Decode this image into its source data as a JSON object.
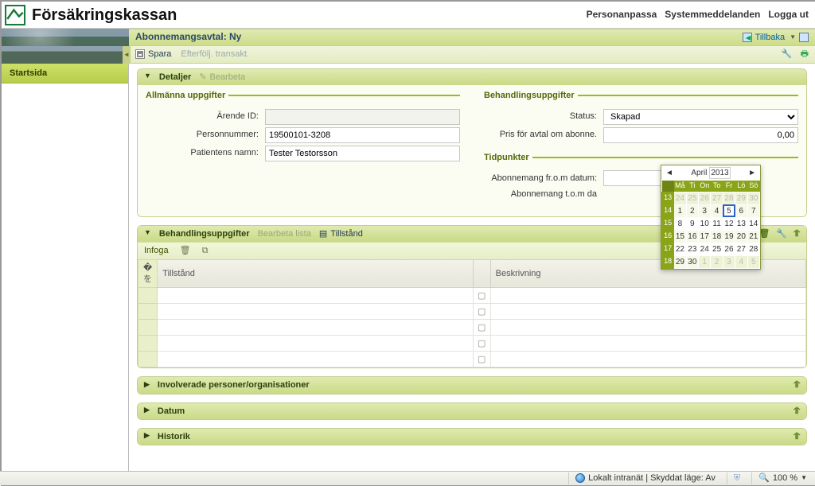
{
  "brand": {
    "name": "Försäkringskassan"
  },
  "topnav": {
    "personalize": "Personanpassa",
    "sysmsg": "Systemmeddelanden",
    "logout": "Logga ut"
  },
  "page": {
    "title": "Abonnemangsavtal: Ny",
    "back": "Tillbaka"
  },
  "toolbar": {
    "save": "Spara",
    "followup": "Efterfölj. transakt."
  },
  "leftnav": {
    "home": "Startsida"
  },
  "details": {
    "panel_title": "Detaljer",
    "edit": "Bearbeta",
    "general_legend": "Allmänna uppgifter",
    "case_id_label": "Ärende ID:",
    "personnr_label": "Personnummer:",
    "personnr_value": "19500101-3208",
    "patient_label": "Patientens namn:",
    "patient_value": "Tester Testorsson",
    "treat_legend": "Behandlingsuppgifter",
    "status_label": "Status:",
    "status_value": "Skapad",
    "price_label": "Pris för avtal om abonne.",
    "price_value": "0,00",
    "dates_legend": "Tidpunkter",
    "from_label": "Abonnemang fr.o.m datum:",
    "to_label": "Abonnemang t.o.m da"
  },
  "treat_panel": {
    "title": "Behandlingsuppgifter",
    "edit_list": "Bearbeta lista",
    "tab": "Tillstånd",
    "insert": "Infoga",
    "col_tillstand": "Tillstånd",
    "col_beskrivning": "Beskrivning"
  },
  "panels": {
    "involved": "Involverade personer/organisationer",
    "datum": "Datum",
    "historik": "Historik"
  },
  "calendar": {
    "month": "April",
    "year": "2013",
    "dow": [
      "Må",
      "Ti",
      "On",
      "To",
      "Fr",
      "Lö",
      "Sö"
    ],
    "weeks": [
      {
        "wk": 13,
        "days": [
          {
            "d": 24,
            "o": true
          },
          {
            "d": 25,
            "o": true
          },
          {
            "d": 26,
            "o": true
          },
          {
            "d": 27,
            "o": true
          },
          {
            "d": 28,
            "o": true
          },
          {
            "d": 29,
            "o": true
          },
          {
            "d": 30,
            "o": true
          }
        ]
      },
      {
        "wk": 14,
        "days": [
          {
            "d": 1
          },
          {
            "d": 2
          },
          {
            "d": 3
          },
          {
            "d": 4
          },
          {
            "d": 5,
            "sel": true
          },
          {
            "d": 6
          },
          {
            "d": 7
          }
        ]
      },
      {
        "wk": 15,
        "days": [
          {
            "d": 8
          },
          {
            "d": 9
          },
          {
            "d": 10
          },
          {
            "d": 11
          },
          {
            "d": 12
          },
          {
            "d": 13
          },
          {
            "d": 14
          }
        ]
      },
      {
        "wk": 16,
        "days": [
          {
            "d": 15
          },
          {
            "d": 16
          },
          {
            "d": 17
          },
          {
            "d": 18
          },
          {
            "d": 19
          },
          {
            "d": 20
          },
          {
            "d": 21
          }
        ]
      },
      {
        "wk": 17,
        "days": [
          {
            "d": 22
          },
          {
            "d": 23
          },
          {
            "d": 24
          },
          {
            "d": 25
          },
          {
            "d": 26
          },
          {
            "d": 27
          },
          {
            "d": 28
          }
        ]
      },
      {
        "wk": 18,
        "days": [
          {
            "d": 29
          },
          {
            "d": 30
          },
          {
            "d": 1,
            "o": true
          },
          {
            "d": 2,
            "o": true
          },
          {
            "d": 3,
            "o": true
          },
          {
            "d": 4,
            "o": true
          },
          {
            "d": 5,
            "o": true
          }
        ]
      }
    ]
  },
  "statusbar": {
    "zone": "Lokalt intranät | Skyddat läge: Av",
    "zoom": "100 %"
  }
}
